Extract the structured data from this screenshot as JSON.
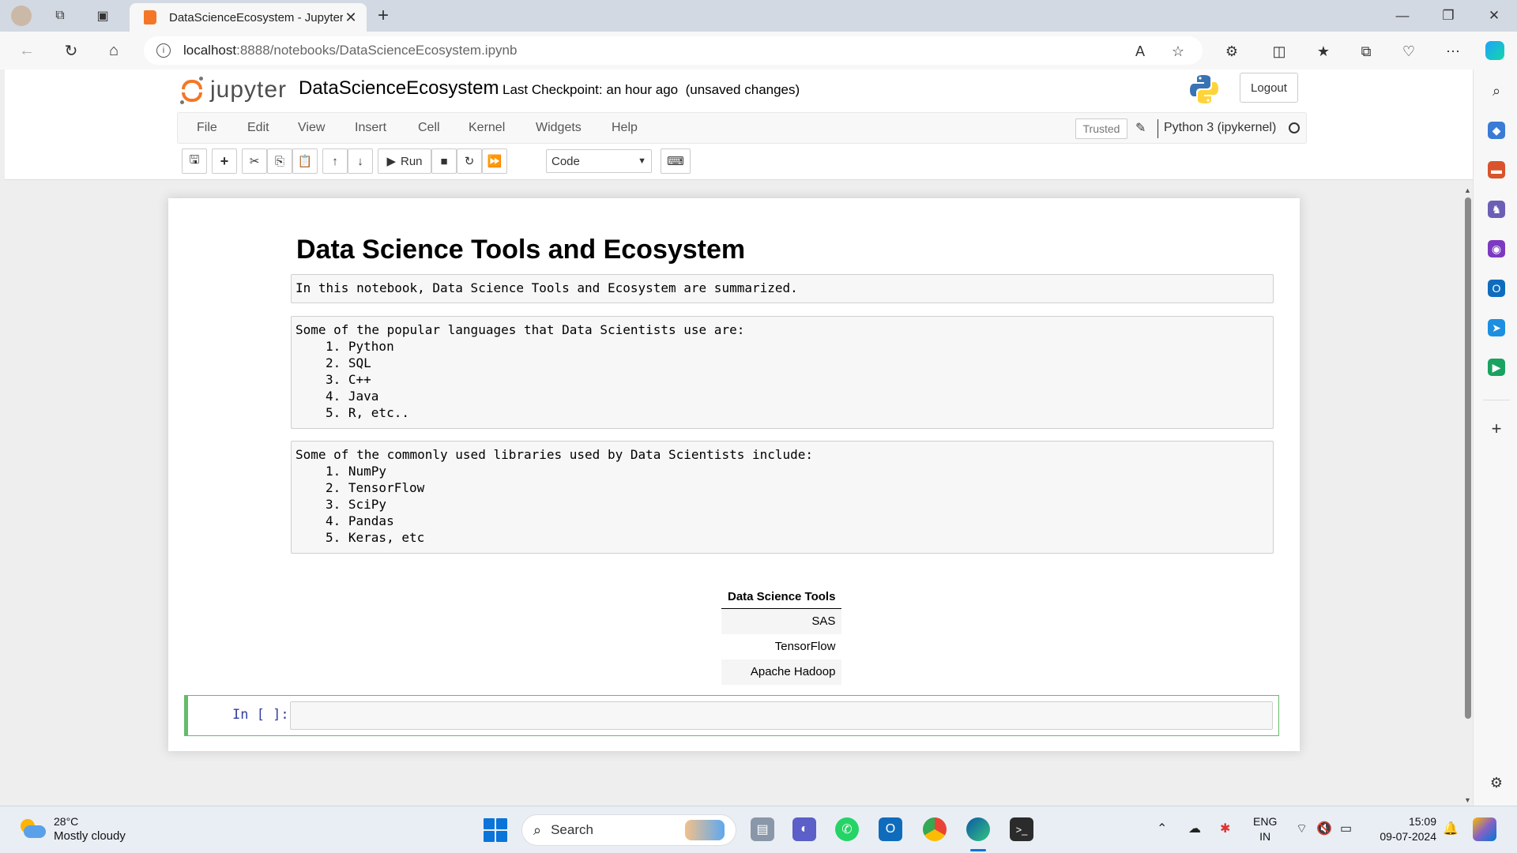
{
  "browser": {
    "tab_title": "DataScienceEcosystem - Jupyter",
    "url_host": "localhost",
    "url_path": ":8888/notebooks/DataScienceEcosystem.ipynb"
  },
  "jupyter": {
    "logo_text": "jupyter",
    "notebook_name": "DataScienceEcosystem",
    "checkpoint_label": "Last Checkpoint:",
    "checkpoint_time": "an hour ago",
    "unsaved": "(unsaved changes)",
    "logout_label": "Logout",
    "menu": [
      "File",
      "Edit",
      "View",
      "Insert",
      "Cell",
      "Kernel",
      "Widgets",
      "Help"
    ],
    "trusted_label": "Trusted",
    "kernel_name": "Python 3 (ipykernel)",
    "run_label": "Run",
    "cell_type": "Code"
  },
  "notebook": {
    "title": "Data Science Tools and Ecosystem",
    "intro": "In this notebook, Data Science Tools and Ecosystem are summarized.",
    "languages_heading": "Some of the popular languages that Data Scientists use are:",
    "languages": [
      "1. Python",
      "2. SQL",
      "3. C++",
      "4. Java",
      "5. R, etc.."
    ],
    "libraries_heading": "Some of the commonly used libraries used by Data Scientists include:",
    "libraries": [
      "1. NumPy",
      "2. TensorFlow",
      "3. SciPy",
      "4. Pandas",
      "5. Keras, etc"
    ],
    "table_header": "Data Science Tools",
    "table_rows": [
      "SAS",
      "TensorFlow",
      "Apache Hadoop"
    ],
    "code_prompt": "In [ ]:"
  },
  "taskbar": {
    "temperature": "28°C",
    "weather": "Mostly cloudy",
    "search_label": "Search",
    "lang_1": "ENG",
    "lang_2": "IN",
    "time": "15:09",
    "date": "09-07-2024"
  },
  "colors": {
    "jupyter_orange": "#f37726",
    "edit_mode_green": "#66bb6a",
    "prompt_blue": "#303f9f"
  }
}
